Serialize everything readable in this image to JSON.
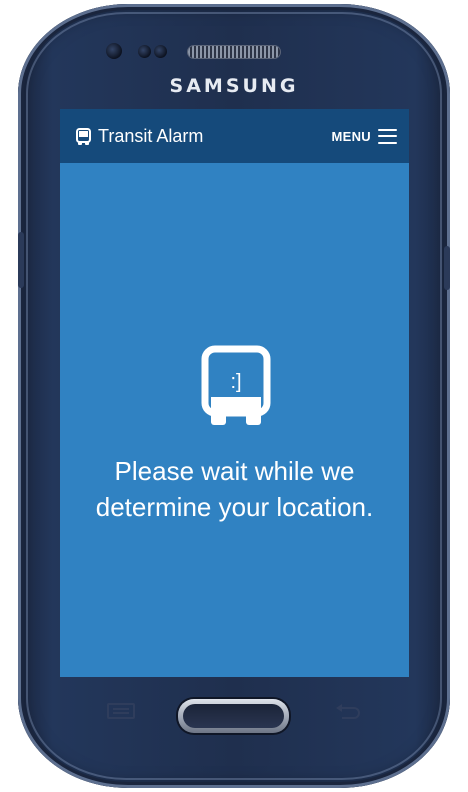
{
  "device": {
    "brand": "SAMSUNG"
  },
  "app": {
    "title": "Transit Alarm",
    "menu_label": "MENU",
    "header_icon": "bus-icon",
    "menu_icon": "hamburger-icon"
  },
  "status": {
    "icon": "bus-face-icon",
    "icon_text": ":]",
    "message_line1": "Please wait while we",
    "message_line2": "determine your location."
  },
  "colors": {
    "app_bar": "#154a7b",
    "screen_bg": "#3082c2",
    "text": "#ffffff",
    "phone_body": "#1f2f4e"
  }
}
